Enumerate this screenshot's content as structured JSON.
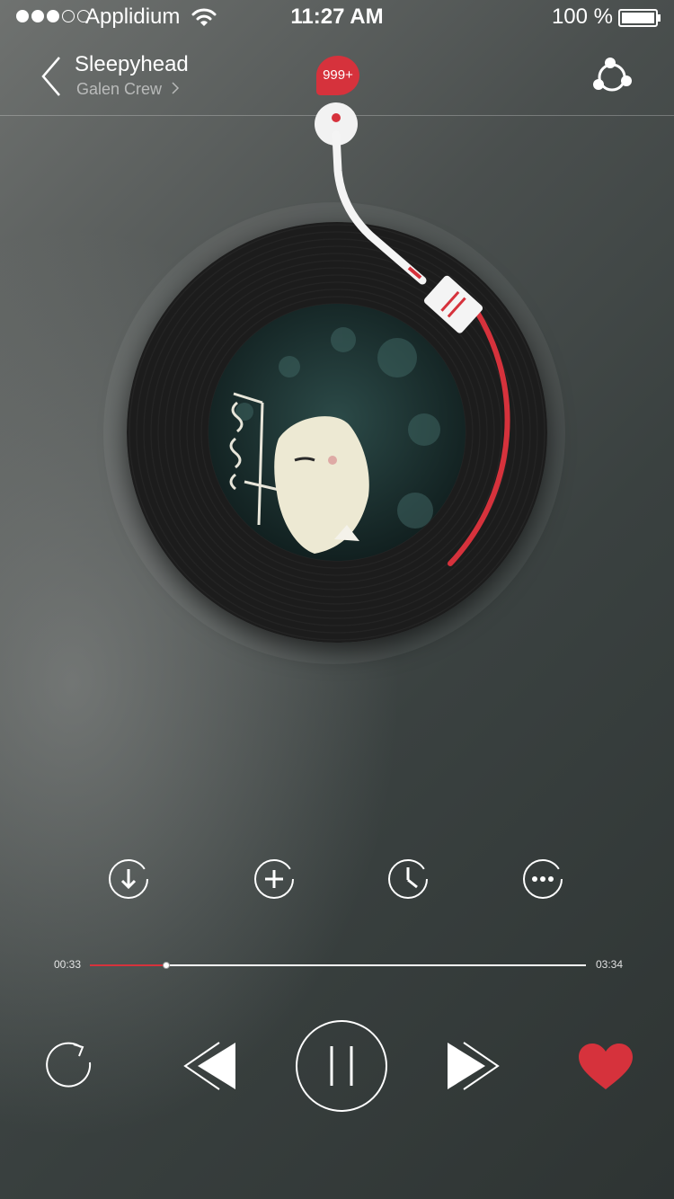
{
  "status_bar": {
    "carrier": "Applidium",
    "signal_strength": 3,
    "time": "11:27 AM",
    "battery": "100 %",
    "icons": [
      "signal-dots-icon",
      "wifi-icon",
      "battery-icon"
    ]
  },
  "nav": {
    "title": "Sleepyhead",
    "artist": "Galen Crew",
    "badge": "999+",
    "icons": [
      "back-chevron-icon",
      "artist-chevron-icon",
      "share-icon"
    ]
  },
  "player": {
    "icons": [
      "vinyl-record",
      "album-art",
      "tonearm"
    ],
    "elapsed": "00:33",
    "duration": "03:34",
    "progress": 0.1545
  },
  "actions": {
    "icons": [
      "download-icon",
      "add-icon",
      "clock-icon",
      "more-icon"
    ]
  },
  "controls": {
    "icons": [
      "repeat-icon",
      "previous-icon",
      "pause-icon",
      "next-icon",
      "heart-icon"
    ]
  },
  "colors": {
    "accent": "#d6323c",
    "background": "#3a4140",
    "record": "#1c1c1c"
  }
}
